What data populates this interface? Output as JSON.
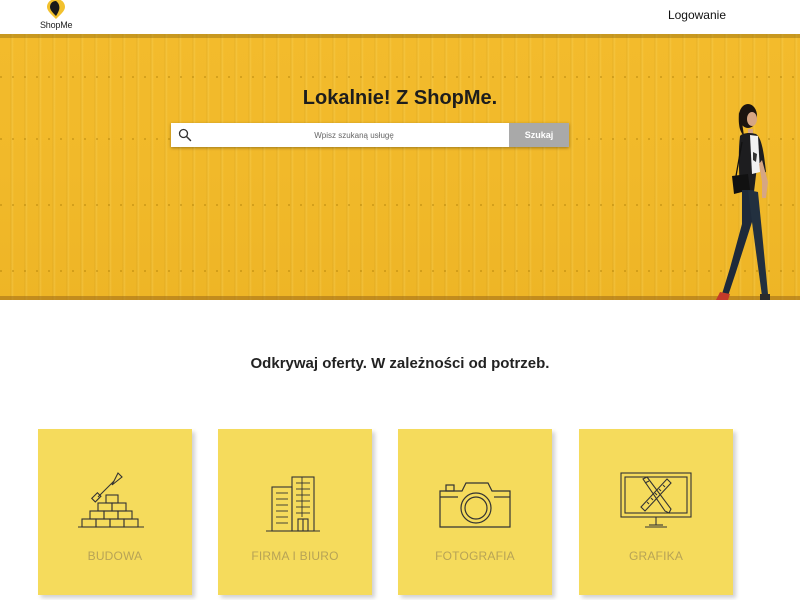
{
  "header": {
    "logo_text": "ShopMe",
    "login_label": "Logowanie"
  },
  "hero": {
    "title": "Lokalnie! Z ShopMe.",
    "search": {
      "placeholder": "Wpisz szukaną usługę",
      "value": "",
      "button_label": "Szukaj"
    }
  },
  "offers": {
    "title": "Odkrywaj oferty. W zależności od potrzeb.",
    "categories": [
      {
        "label": "BUDOWA",
        "icon": "construction-icon"
      },
      {
        "label": "FIRMA I BIURO",
        "icon": "office-building-icon"
      },
      {
        "label": "FOTOGRAFIA",
        "icon": "camera-icon"
      },
      {
        "label": "GRAFIKA",
        "icon": "graphic-design-icon"
      }
    ]
  },
  "colors": {
    "hero_yellow": "#f1b92a",
    "card_yellow": "#f5db5c",
    "card_label": "#b7a356",
    "search_button": "#a9a9a9"
  }
}
